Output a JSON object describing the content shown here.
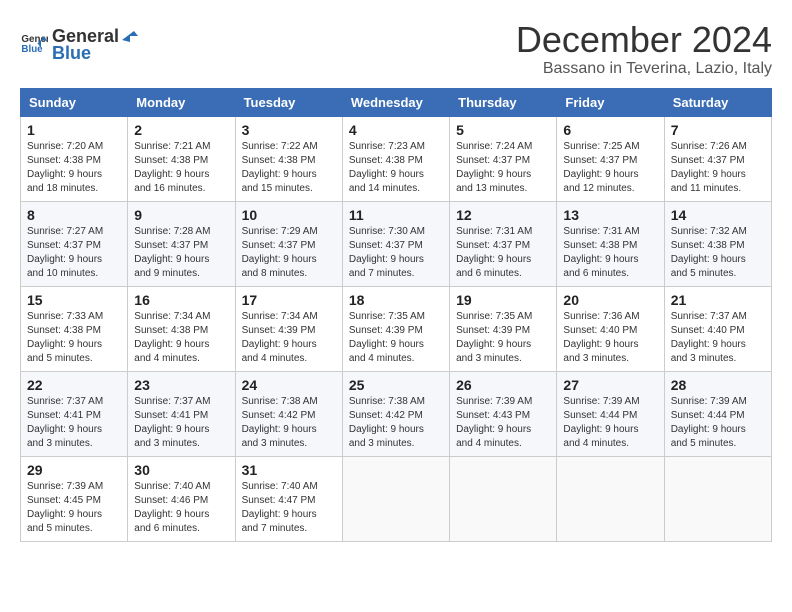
{
  "header": {
    "logo_general": "General",
    "logo_blue": "Blue",
    "month": "December 2024",
    "location": "Bassano in Teverina, Lazio, Italy"
  },
  "weekdays": [
    "Sunday",
    "Monday",
    "Tuesday",
    "Wednesday",
    "Thursday",
    "Friday",
    "Saturday"
  ],
  "weeks": [
    [
      {
        "day": "1",
        "sunrise": "7:20 AM",
        "sunset": "4:38 PM",
        "daylight": "9 hours and 18 minutes."
      },
      {
        "day": "2",
        "sunrise": "7:21 AM",
        "sunset": "4:38 PM",
        "daylight": "9 hours and 16 minutes."
      },
      {
        "day": "3",
        "sunrise": "7:22 AM",
        "sunset": "4:38 PM",
        "daylight": "9 hours and 15 minutes."
      },
      {
        "day": "4",
        "sunrise": "7:23 AM",
        "sunset": "4:38 PM",
        "daylight": "9 hours and 14 minutes."
      },
      {
        "day": "5",
        "sunrise": "7:24 AM",
        "sunset": "4:37 PM",
        "daylight": "9 hours and 13 minutes."
      },
      {
        "day": "6",
        "sunrise": "7:25 AM",
        "sunset": "4:37 PM",
        "daylight": "9 hours and 12 minutes."
      },
      {
        "day": "7",
        "sunrise": "7:26 AM",
        "sunset": "4:37 PM",
        "daylight": "9 hours and 11 minutes."
      }
    ],
    [
      {
        "day": "8",
        "sunrise": "7:27 AM",
        "sunset": "4:37 PM",
        "daylight": "9 hours and 10 minutes."
      },
      {
        "day": "9",
        "sunrise": "7:28 AM",
        "sunset": "4:37 PM",
        "daylight": "9 hours and 9 minutes."
      },
      {
        "day": "10",
        "sunrise": "7:29 AM",
        "sunset": "4:37 PM",
        "daylight": "9 hours and 8 minutes."
      },
      {
        "day": "11",
        "sunrise": "7:30 AM",
        "sunset": "4:37 PM",
        "daylight": "9 hours and 7 minutes."
      },
      {
        "day": "12",
        "sunrise": "7:31 AM",
        "sunset": "4:37 PM",
        "daylight": "9 hours and 6 minutes."
      },
      {
        "day": "13",
        "sunrise": "7:31 AM",
        "sunset": "4:38 PM",
        "daylight": "9 hours and 6 minutes."
      },
      {
        "day": "14",
        "sunrise": "7:32 AM",
        "sunset": "4:38 PM",
        "daylight": "9 hours and 5 minutes."
      }
    ],
    [
      {
        "day": "15",
        "sunrise": "7:33 AM",
        "sunset": "4:38 PM",
        "daylight": "9 hours and 5 minutes."
      },
      {
        "day": "16",
        "sunrise": "7:34 AM",
        "sunset": "4:38 PM",
        "daylight": "9 hours and 4 minutes."
      },
      {
        "day": "17",
        "sunrise": "7:34 AM",
        "sunset": "4:39 PM",
        "daylight": "9 hours and 4 minutes."
      },
      {
        "day": "18",
        "sunrise": "7:35 AM",
        "sunset": "4:39 PM",
        "daylight": "9 hours and 4 minutes."
      },
      {
        "day": "19",
        "sunrise": "7:35 AM",
        "sunset": "4:39 PM",
        "daylight": "9 hours and 3 minutes."
      },
      {
        "day": "20",
        "sunrise": "7:36 AM",
        "sunset": "4:40 PM",
        "daylight": "9 hours and 3 minutes."
      },
      {
        "day": "21",
        "sunrise": "7:37 AM",
        "sunset": "4:40 PM",
        "daylight": "9 hours and 3 minutes."
      }
    ],
    [
      {
        "day": "22",
        "sunrise": "7:37 AM",
        "sunset": "4:41 PM",
        "daylight": "9 hours and 3 minutes."
      },
      {
        "day": "23",
        "sunrise": "7:37 AM",
        "sunset": "4:41 PM",
        "daylight": "9 hours and 3 minutes."
      },
      {
        "day": "24",
        "sunrise": "7:38 AM",
        "sunset": "4:42 PM",
        "daylight": "9 hours and 3 minutes."
      },
      {
        "day": "25",
        "sunrise": "7:38 AM",
        "sunset": "4:42 PM",
        "daylight": "9 hours and 3 minutes."
      },
      {
        "day": "26",
        "sunrise": "7:39 AM",
        "sunset": "4:43 PM",
        "daylight": "9 hours and 4 minutes."
      },
      {
        "day": "27",
        "sunrise": "7:39 AM",
        "sunset": "4:44 PM",
        "daylight": "9 hours and 4 minutes."
      },
      {
        "day": "28",
        "sunrise": "7:39 AM",
        "sunset": "4:44 PM",
        "daylight": "9 hours and 5 minutes."
      }
    ],
    [
      {
        "day": "29",
        "sunrise": "7:39 AM",
        "sunset": "4:45 PM",
        "daylight": "9 hours and 5 minutes."
      },
      {
        "day": "30",
        "sunrise": "7:40 AM",
        "sunset": "4:46 PM",
        "daylight": "9 hours and 6 minutes."
      },
      {
        "day": "31",
        "sunrise": "7:40 AM",
        "sunset": "4:47 PM",
        "daylight": "9 hours and 7 minutes."
      },
      null,
      null,
      null,
      null
    ]
  ]
}
